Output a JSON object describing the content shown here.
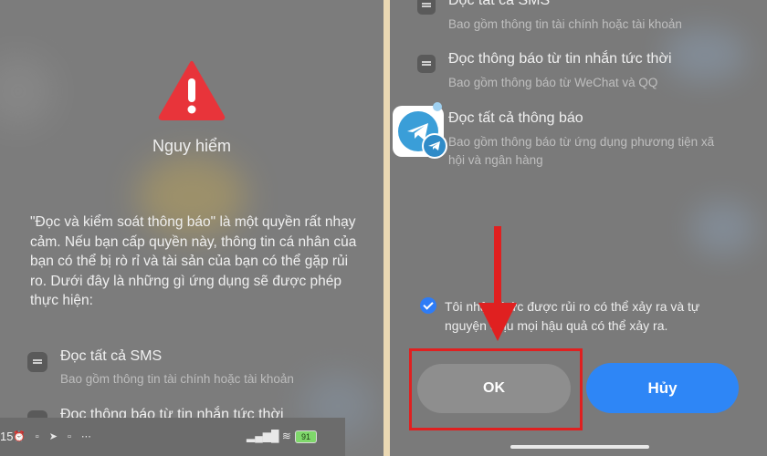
{
  "left": {
    "title": "Nguy hiểm",
    "description": "\"Đọc và kiểm soát thông báo\" là một quyền rất nhạy cảm. Nếu bạn cấp quyền này, thông tin cá nhân của bạn có thể bị rò rỉ và tài sản của bạn có thể gặp rủi ro. Dưới đây là những gì ứng dụng sẽ được phép thực hiện:",
    "permissions": [
      {
        "title": "Đọc tất cả SMS",
        "subtitle": "Bao gồm thông tin tài chính hoặc tài khoản"
      },
      {
        "title": "Đọc thông báo từ tin nhắn tức thời",
        "subtitle": ""
      }
    ],
    "statusbar": {
      "time": "15",
      "battery": "91"
    }
  },
  "right": {
    "permissions": [
      {
        "title": "Đọc tất cả SMS",
        "subtitle": "Bao gồm thông tin tài chính hoặc tài khoản"
      },
      {
        "title": "Đọc thông báo từ tin nhắn tức thời",
        "subtitle": "Bao gồm thông báo từ WeChat và QQ"
      },
      {
        "title": "Đọc tất cả thông báo",
        "subtitle": "Bao gồm thông báo từ ứng dụng phương tiện xã hội và ngân hàng"
      }
    ],
    "consent_text": "Tôi nhận thức được rủi ro có thể xảy ra và tự nguyện chịu mọi hậu quả có thể xảy ra.",
    "ok_label": "OK",
    "cancel_label": "Hủy"
  },
  "colors": {
    "danger": "#e8343a",
    "accent": "#2e86f6",
    "highlight": "#e02020"
  }
}
